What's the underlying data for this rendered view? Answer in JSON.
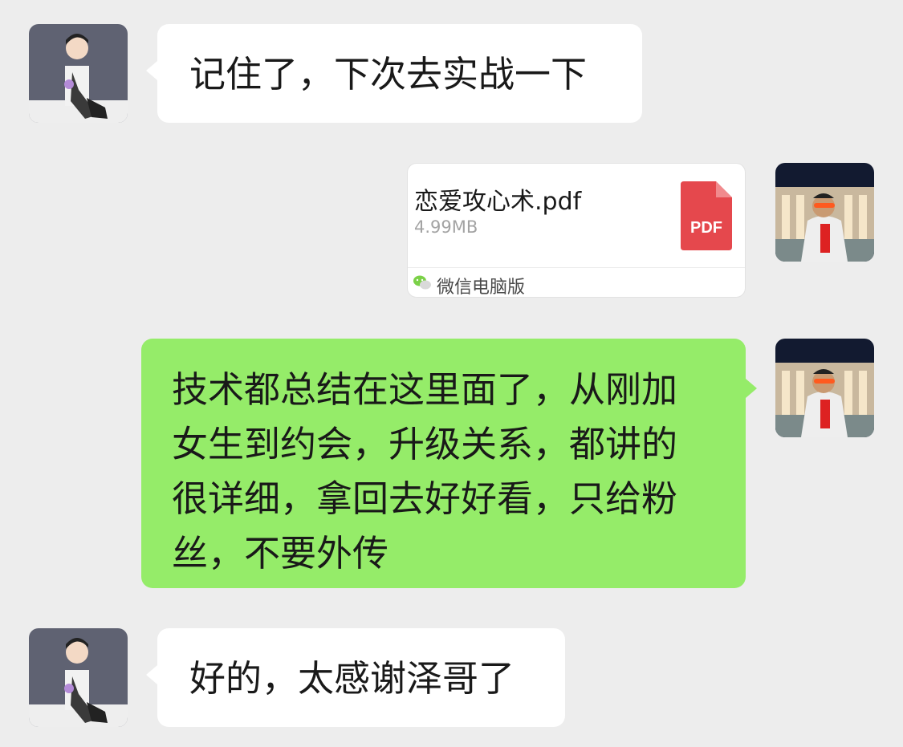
{
  "messages": [
    {
      "side": "left",
      "type": "text",
      "text": "记住了，下次去实战一下"
    },
    {
      "side": "right",
      "type": "file",
      "file_name": "恋爱攻心术.pdf",
      "file_size": "4.99MB",
      "file_badge": "PDF",
      "source": "微信电脑版"
    },
    {
      "side": "right",
      "type": "text",
      "lines": [
        "技术都总结在这里面了，从刚加",
        "女生到约会，升级关系，都讲的",
        "很详细，拿回去好好看，只给粉",
        "丝，不要外传"
      ]
    },
    {
      "side": "left",
      "type": "text",
      "text": "好的，太感谢泽哥了"
    }
  ],
  "colors": {
    "background": "#ededed",
    "incoming_bubble": "#ffffff",
    "outgoing_bubble": "#95ec69",
    "pdf_icon": "#e5484d",
    "wechat_green": "#7bd148"
  },
  "icons": {
    "pdf": "pdf-file-icon",
    "wechat": "wechat-logo-icon",
    "contact_avatar": "cartoon-boy-avatar",
    "self_avatar": "man-in-sunglasses-avatar"
  }
}
